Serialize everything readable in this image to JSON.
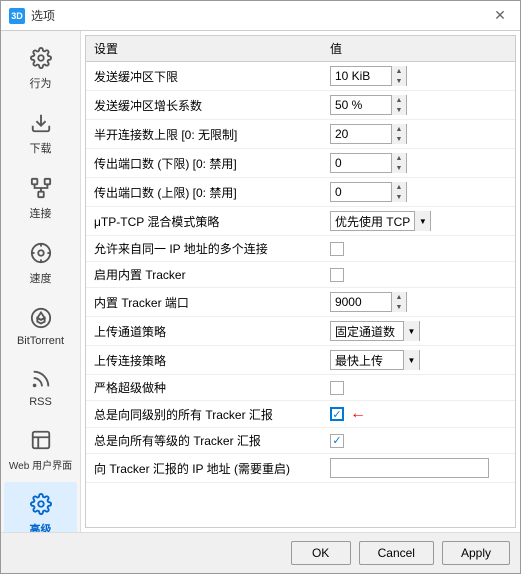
{
  "window": {
    "title": "选项",
    "icon_label": "3D"
  },
  "sidebar": {
    "items": [
      {
        "id": "behavior",
        "label": "行为",
        "icon": "gear"
      },
      {
        "id": "download",
        "label": "下载",
        "icon": "download"
      },
      {
        "id": "connection",
        "label": "连接",
        "icon": "network"
      },
      {
        "id": "speed",
        "label": "速度",
        "icon": "palette"
      },
      {
        "id": "bittorrent",
        "label": "BitTorrent",
        "icon": "bittorrent"
      },
      {
        "id": "rss",
        "label": "RSS",
        "icon": "rss"
      },
      {
        "id": "webui",
        "label": "Web 用户界面",
        "icon": "webui"
      },
      {
        "id": "advanced",
        "label": "高级",
        "icon": "advanced",
        "active": true
      }
    ]
  },
  "table": {
    "headers": [
      "设置",
      "值"
    ],
    "rows": [
      {
        "setting": "发送缓冲区下限",
        "value_type": "spinner",
        "value": "10 KiB"
      },
      {
        "setting": "发送缓冲区增长系数",
        "value_type": "spinner",
        "value": "50 %"
      },
      {
        "setting": "半开连接数上限 [0: 无限制]",
        "value_type": "spinner",
        "value": "20"
      },
      {
        "setting": "传出端口数 (下限) [0: 禁用]",
        "value_type": "spinner",
        "value": "0"
      },
      {
        "setting": "传出端口数 (上限) [0: 禁用]",
        "value_type": "spinner",
        "value": "0"
      },
      {
        "setting": "μTP-TCP 混合模式策略",
        "value_type": "dropdown",
        "value": "优先使用 TCP"
      },
      {
        "setting": "允许来自同一 IP 地址的多个连接",
        "value_type": "checkbox",
        "checked": false
      },
      {
        "setting": "启用内置 Tracker",
        "value_type": "checkbox",
        "checked": false
      },
      {
        "setting": "内置 Tracker 端口",
        "value_type": "spinner",
        "value": "9000"
      },
      {
        "setting": "上传通道策略",
        "value_type": "dropdown",
        "value": "固定通道数"
      },
      {
        "setting": "上传连接策略",
        "value_type": "dropdown",
        "value": "最快上传"
      },
      {
        "setting": "严格超级做种",
        "value_type": "checkbox",
        "checked": false
      },
      {
        "setting": "总是向同级别的所有 Tracker 汇报",
        "value_type": "checkbox",
        "checked": true,
        "highlighted": true,
        "arrow": true
      },
      {
        "setting": "总是向所有等级的 Tracker 汇报",
        "value_type": "checkbox",
        "checked": true
      },
      {
        "setting": "向 Tracker 汇报的 IP 地址 (需要重启)",
        "value_type": "text",
        "value": ""
      }
    ]
  },
  "buttons": {
    "ok": "OK",
    "cancel": "Cancel",
    "apply": "Apply"
  }
}
